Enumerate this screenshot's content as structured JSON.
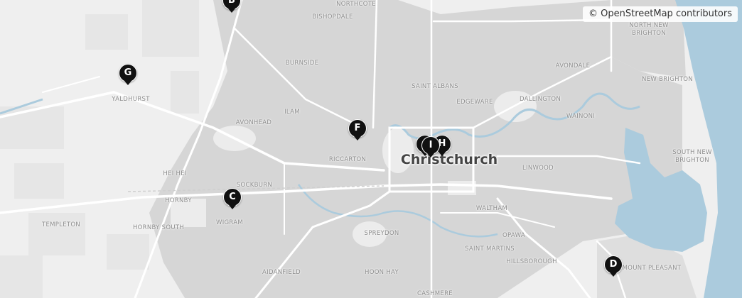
{
  "attribution": "© OpenStreetMap contributors",
  "city_label": "Christchurch",
  "suburbs": [
    {
      "id": "northcote",
      "name": "NORTHCOTE"
    },
    {
      "id": "bishopdale",
      "name": "BISHOPDALE"
    },
    {
      "id": "north-new-brighton",
      "name": "NORTH NEW\nBRIGHTON"
    },
    {
      "id": "burnside",
      "name": "BURNSIDE"
    },
    {
      "id": "avondale",
      "name": "AVONDALE"
    },
    {
      "id": "new-brighton",
      "name": "NEW BRIGHTON"
    },
    {
      "id": "yaldhurst",
      "name": "YALDHURST"
    },
    {
      "id": "saint-albans",
      "name": "SAINT ALBANS"
    },
    {
      "id": "edgeware",
      "name": "EDGEWARE"
    },
    {
      "id": "dallington",
      "name": "DALLINGTON"
    },
    {
      "id": "ilam",
      "name": "ILAM"
    },
    {
      "id": "wainoni",
      "name": "WAINONI"
    },
    {
      "id": "avonhead",
      "name": "AVONHEAD"
    },
    {
      "id": "south-new-brighton",
      "name": "SOUTH NEW\nBRIGHTON"
    },
    {
      "id": "riccarton",
      "name": "RICCARTON"
    },
    {
      "id": "hei-hei",
      "name": "HEI HEI"
    },
    {
      "id": "linwood",
      "name": "LINWOOD"
    },
    {
      "id": "sockburn",
      "name": "SOCKBURN"
    },
    {
      "id": "hornby",
      "name": "HORNBY"
    },
    {
      "id": "waltham",
      "name": "WALTHAM"
    },
    {
      "id": "templeton",
      "name": "TEMPLETON"
    },
    {
      "id": "hornby-south",
      "name": "HORNBY SOUTH"
    },
    {
      "id": "wigram",
      "name": "WIGRAM"
    },
    {
      "id": "spreydon",
      "name": "SPREYDON"
    },
    {
      "id": "opawa",
      "name": "OPAWA"
    },
    {
      "id": "saint-martins",
      "name": "SAINT MARTINS"
    },
    {
      "id": "hillsborough",
      "name": "HILLSBOROUGH"
    },
    {
      "id": "aidanfield",
      "name": "AIDANFIELD"
    },
    {
      "id": "hoon-hay",
      "name": "HOON HAY"
    },
    {
      "id": "mount-pleasant",
      "name": "MOUNT PLEASANT"
    },
    {
      "id": "cashmere",
      "name": "CASHMERE"
    }
  ],
  "markers": [
    {
      "id": "B",
      "label": "B"
    },
    {
      "id": "G",
      "label": "G"
    },
    {
      "id": "F",
      "label": "F"
    },
    {
      "id": "H",
      "label": "H"
    },
    {
      "id": "I1",
      "label": "I"
    },
    {
      "id": "I2",
      "label": "I"
    },
    {
      "id": "C",
      "label": "C"
    },
    {
      "id": "D",
      "label": "D"
    }
  ],
  "colors": {
    "sea": "#abcbdd",
    "road": "#ffffff",
    "urban": "#d4d4d4",
    "marker": "#111111",
    "marker_text": "#ffffff"
  }
}
